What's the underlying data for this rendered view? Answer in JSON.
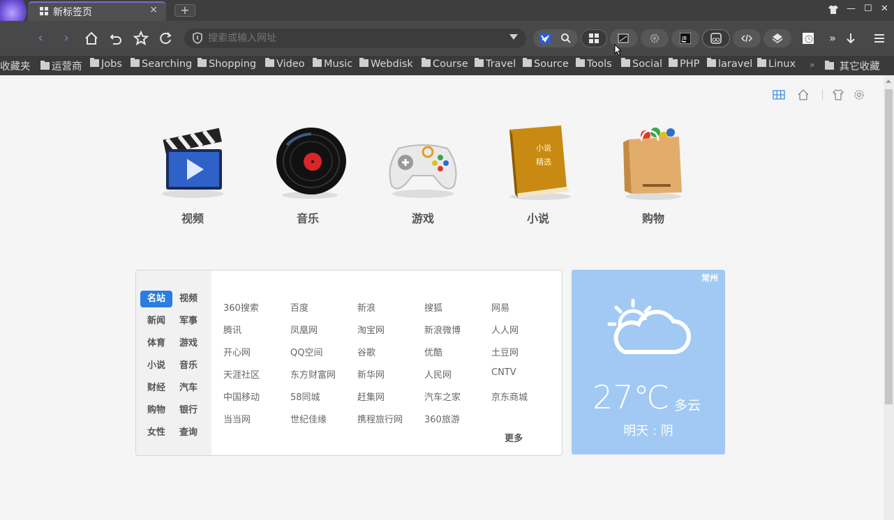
{
  "tab": {
    "title": "新标签页",
    "close": "×"
  },
  "newtab": "+",
  "window_controls": {
    "minimize": "—",
    "maximize": "☐",
    "close": "✕"
  },
  "address": {
    "placeholder": "搜索或输入网址",
    "value": ""
  },
  "bookmarks": [
    "收藏夹",
    "运营商",
    "Jobs",
    "Searching",
    "Shopping",
    "Video",
    "Music",
    "Webdisk",
    "Course",
    "Travel",
    "Source",
    "Tools",
    "Social",
    "PHP",
    "laravel",
    "Linux"
  ],
  "bookmarks_overflow": "»",
  "bookmarks_other": "其它收藏",
  "toolbar_overflow": "»",
  "categories": [
    "视频",
    "音乐",
    "游戏",
    "小说",
    "购物"
  ],
  "sidenav": [
    [
      "名站",
      "视频"
    ],
    [
      "新闻",
      "军事"
    ],
    [
      "体育",
      "游戏"
    ],
    [
      "小说",
      "音乐"
    ],
    [
      "财经",
      "汽车"
    ],
    [
      "购物",
      "银行"
    ],
    [
      "女性",
      "查询"
    ]
  ],
  "sites": [
    [
      "360搜索",
      "百度",
      "新浪",
      "搜狐",
      "网易"
    ],
    [
      "腾讯",
      "凤凰网",
      "淘宝网",
      "新浪微博",
      "人人网"
    ],
    [
      "开心网",
      "QQ空间",
      "谷歌",
      "优酷",
      "土豆网"
    ],
    [
      "天涯社区",
      "东方财富网",
      "新华网",
      "人民网",
      "CNTV"
    ],
    [
      "中国移动",
      "58同城",
      "赶集网",
      "汽车之家",
      "京东商城"
    ],
    [
      "当当网",
      "世纪佳缘",
      "携程旅行网",
      "360旅游"
    ]
  ],
  "more": "更多",
  "weather": {
    "city": "常州",
    "temp": "27℃",
    "condition": "多云",
    "tomorrow": "明天 : 阴"
  },
  "colors": {
    "accent": "#2a7de1",
    "weather_bg": "#a1c9f4",
    "chrome": "#484848"
  }
}
